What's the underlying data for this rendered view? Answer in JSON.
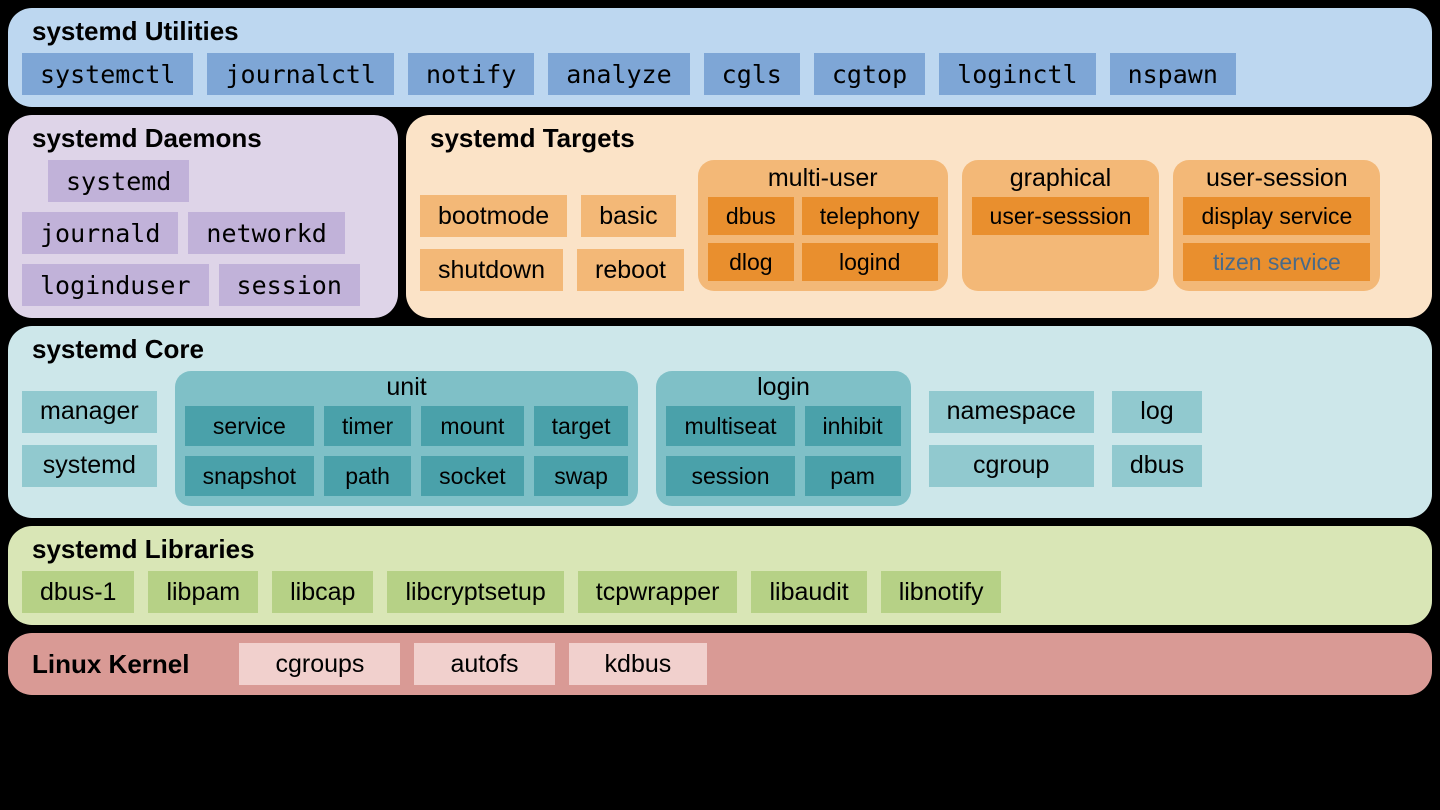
{
  "utilities": {
    "title": "systemd Utilities",
    "items": [
      "systemctl",
      "journalctl",
      "notify",
      "analyze",
      "cgls",
      "cgtop",
      "loginctl",
      "nspawn"
    ]
  },
  "daemons": {
    "title": "systemd Daemons",
    "rows": [
      [
        "systemd"
      ],
      [
        "journald",
        "networkd"
      ],
      [
        "loginduser",
        "session"
      ]
    ]
  },
  "targets": {
    "title": "systemd Targets",
    "simple": [
      [
        "bootmode",
        "basic"
      ],
      [
        "shutdown",
        "reboot"
      ]
    ],
    "groups": [
      {
        "title": "multi-user",
        "cols": 2,
        "items": [
          "dbus",
          "telephony",
          "dlog",
          "logind"
        ]
      },
      {
        "title": "graphical",
        "cols": 1,
        "items": [
          "user-sesssion"
        ]
      },
      {
        "title": "user-session",
        "cols": 1,
        "items": [
          "display service",
          "tizen service"
        ],
        "muted": [
          1
        ]
      }
    ]
  },
  "core": {
    "title": "systemd Core",
    "left": [
      "manager",
      "systemd"
    ],
    "unit": {
      "title": "unit",
      "cols": 4,
      "items": [
        "service",
        "timer",
        "mount",
        "target",
        "snapshot",
        "path",
        "socket",
        "swap"
      ]
    },
    "login": {
      "title": "login",
      "cols": 2,
      "items": [
        "multiseat",
        "inhibit",
        "session",
        "pam"
      ]
    },
    "right": [
      "namespace",
      "log",
      "cgroup",
      "dbus"
    ]
  },
  "libs": {
    "title": "systemd Libraries",
    "items": [
      "dbus-1",
      "libpam",
      "libcap",
      "libcryptsetup",
      "tcpwrapper",
      "libaudit",
      "libnotify"
    ]
  },
  "kernel": {
    "title": "Linux Kernel",
    "items": [
      "cgroups",
      "autofs",
      "kdbus"
    ]
  }
}
